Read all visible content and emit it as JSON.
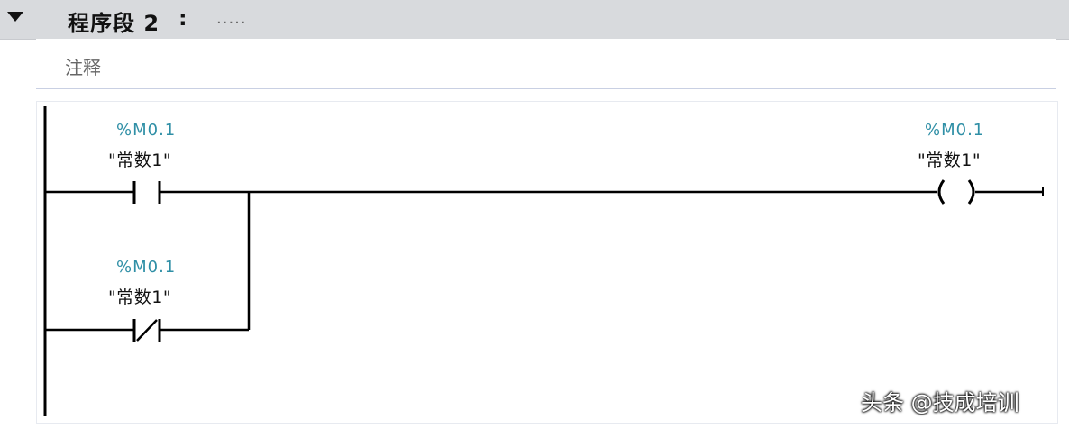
{
  "network": {
    "title": "程序段 2",
    "colon": ":",
    "dots": "....."
  },
  "comment": {
    "label": "注释"
  },
  "rungs": {
    "contact_no": {
      "address": "%M0.1",
      "tag": "\"常数1\""
    },
    "contact_nc": {
      "address": "%M0.1",
      "tag": "\"常数1\""
    },
    "coil": {
      "address": "%M0.1",
      "tag": "\"常数1\""
    }
  },
  "watermark": {
    "text": "头条 @技成培训"
  }
}
